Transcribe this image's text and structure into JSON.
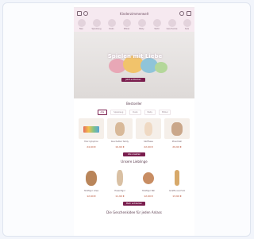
{
  "header": {
    "logo": "Kinderzimmerwelt",
    "categories": [
      {
        "label": "Neu"
      },
      {
        "label": "Spielzeug"
      },
      {
        "label": "Deko"
      },
      {
        "label": "Möbel"
      },
      {
        "label": "Baby"
      },
      {
        "label": "Textil"
      },
      {
        "label": "Geschenke"
      },
      {
        "label": "Sale"
      }
    ]
  },
  "hero": {
    "title": "Spielen mit Liebe",
    "cta": "Jetzt entdecken"
  },
  "bestsellers": {
    "title": "Bestseller",
    "tabs": [
      "Alle",
      "Spielzeug",
      "Deko",
      "Baby",
      "Möbel"
    ],
    "products": [
      {
        "name": "Holz Xylophon",
        "price": "24,90 €"
      },
      {
        "name": "Kuscheltier Teddy",
        "price": "19,90 €"
      },
      {
        "name": "Stoffhase",
        "price": "22,90 €"
      },
      {
        "name": "Plüschbär",
        "price": "29,90 €"
      }
    ],
    "button": "Alle ansehen"
  },
  "lieblinge": {
    "title": "Unsere Lieblinge",
    "products": [
      {
        "name": "Holzfigur Löwe",
        "price": "12,90 €"
      },
      {
        "name": "Hasenfigur",
        "price": "11,90 €"
      },
      {
        "name": "Holzfigur Bär",
        "price": "12,90 €"
      },
      {
        "name": "Giraffe aus Holz",
        "price": "13,90 €"
      }
    ],
    "button": "Mehr entdecken"
  },
  "footer": {
    "title": "Die Geschenkidee für jeden Anlass"
  },
  "colors": {
    "accent": "#7a1e4e",
    "header_bg": "#f6e9f0",
    "price": "#b3462a"
  }
}
